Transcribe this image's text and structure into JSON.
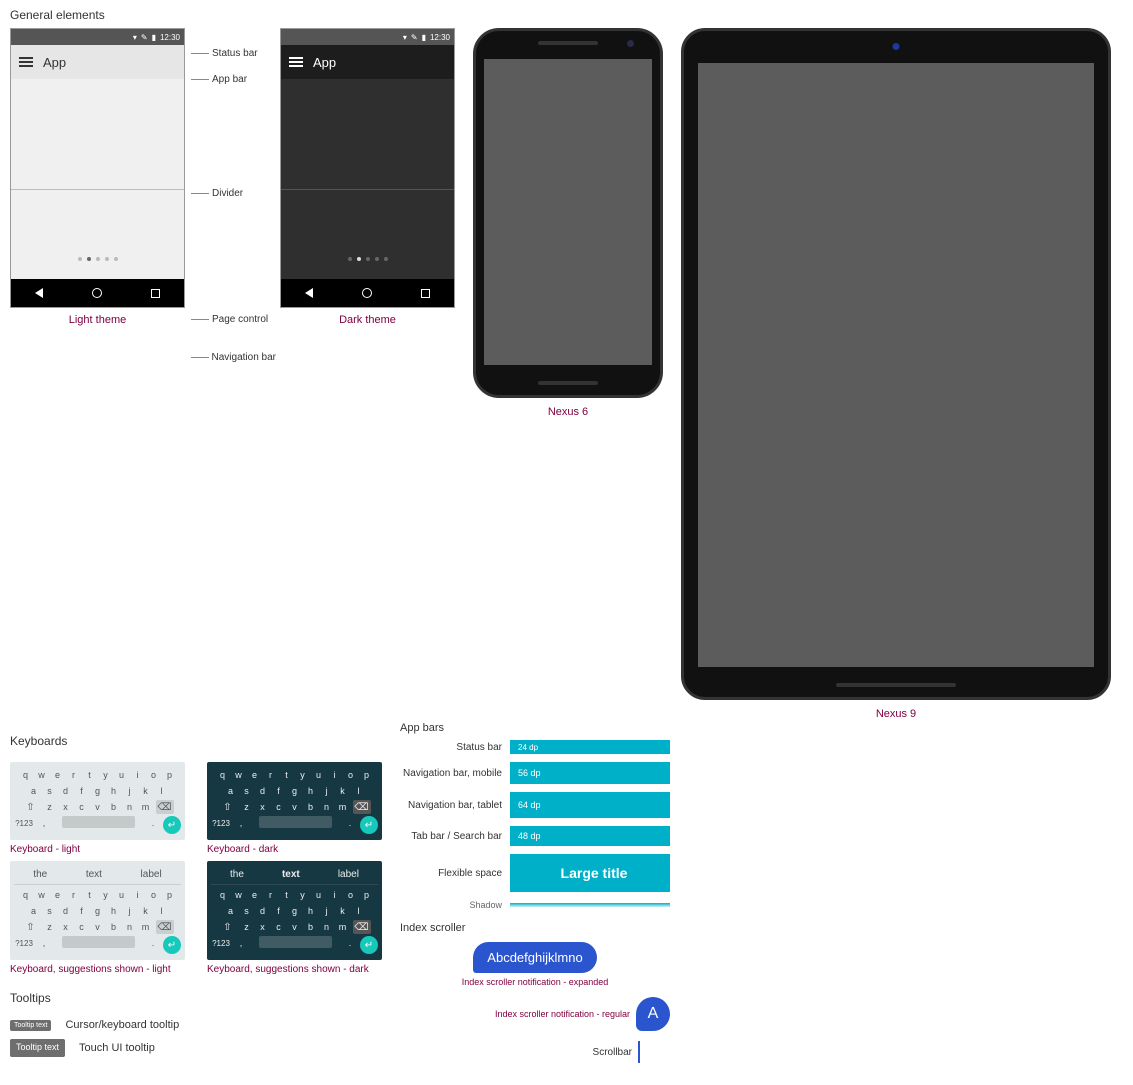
{
  "sections": {
    "general": "General elements",
    "keyboards": "Keyboards",
    "tooltips": "Tooltips",
    "appbars": "App bars",
    "index": "Index scroller"
  },
  "leaders": {
    "status": "Status bar",
    "appbar": "App bar",
    "divider": "Divider",
    "page": "Page control",
    "nav": "Navigation bar"
  },
  "phones": {
    "light_caption": "Light theme",
    "dark_caption": "Dark theme",
    "app_title": "App",
    "time": "12:30"
  },
  "devices": {
    "n6": "Nexus 6",
    "n9": "Nexus 9"
  },
  "keyboard": {
    "row1": [
      "q",
      "w",
      "e",
      "r",
      "t",
      "y",
      "u",
      "i",
      "o",
      "p"
    ],
    "row2": [
      "a",
      "s",
      "d",
      "f",
      "g",
      "h",
      "j",
      "k",
      "l"
    ],
    "row3": [
      "z",
      "x",
      "c",
      "v",
      "b",
      "n",
      "m"
    ],
    "sym": "?123",
    "sugg": [
      "the",
      "text",
      "label"
    ],
    "light": "Keyboard - light",
    "dark": "Keyboard - dark",
    "light_sugg": "Keyboard, suggestions shown - light",
    "dark_sugg": "Keyboard, suggestions shown - dark"
  },
  "appbars": {
    "status": {
      "label": "Status bar",
      "value": "24 dp"
    },
    "navm": {
      "label": "Navigation bar, mobile",
      "value": "56 dp"
    },
    "navt": {
      "label": "Navigation bar, tablet",
      "value": "64 dp"
    },
    "tab": {
      "label": "Tab bar / Search bar",
      "value": "48 dp"
    },
    "flex": {
      "label": "Flexible space",
      "value": "Large title"
    },
    "shadow": {
      "label": "Shadow"
    }
  },
  "index": {
    "expanded_text": "Abcdefghijklmno",
    "expanded_caption": "Index scroller notification - expanded",
    "regular_text": "A",
    "regular_caption": "Index scroller notification - regular",
    "scrollbar_caption": "Scrollbar"
  },
  "tooltips": {
    "small_text": "Tooltip text",
    "small_caption": "Cursor/keyboard tooltip",
    "big_text": "Tooltip\ntext",
    "big_caption": "Touch UI tooltip"
  }
}
